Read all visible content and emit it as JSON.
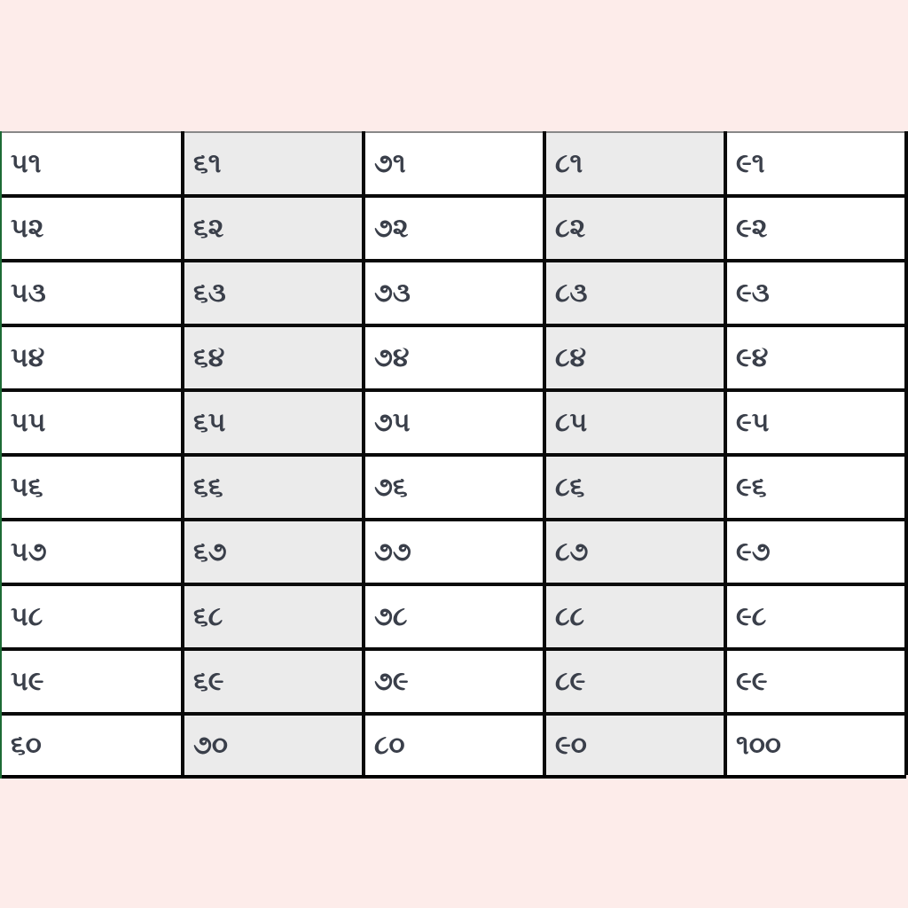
{
  "table": {
    "columns": [
      {
        "shaded": false,
        "cells": [
          "૫૧",
          "૫૨",
          "૫૩",
          "૫૪",
          "૫૫",
          "૫૬",
          "૫૭",
          "૫૮",
          "૫૯",
          "૬૦"
        ]
      },
      {
        "shaded": true,
        "cells": [
          "૬૧",
          "૬૨",
          "૬૩",
          "૬૪",
          "૬૫",
          "૬૬",
          "૬૭",
          "૬૮",
          "૬૯",
          "૭૦"
        ]
      },
      {
        "shaded": false,
        "cells": [
          "૭૧",
          "૭૨",
          "૭૩",
          "૭૪",
          "૭૫",
          "૭૬",
          "૭૭",
          "૭૮",
          "૭૯",
          "૮૦"
        ]
      },
      {
        "shaded": true,
        "cells": [
          "૮૧",
          "૮૨",
          "૮૩",
          "૮૪",
          "૮૫",
          "૮૬",
          "૮૭",
          "૮૮",
          "૮૯",
          "૯૦"
        ]
      },
      {
        "shaded": false,
        "cells": [
          "૯૧",
          "૯૨",
          "૯૩",
          "૯૪",
          "૯૫",
          "૯૬",
          "૯૭",
          "૯૮",
          "૯૯",
          "૧૦૦"
        ]
      }
    ]
  },
  "colors": {
    "page_background": "#fdecea",
    "cell_white": "#ffffff",
    "cell_shaded": "#ebebeb",
    "grid_line": "#0a0a0a",
    "text": "#3a3f4a"
  }
}
